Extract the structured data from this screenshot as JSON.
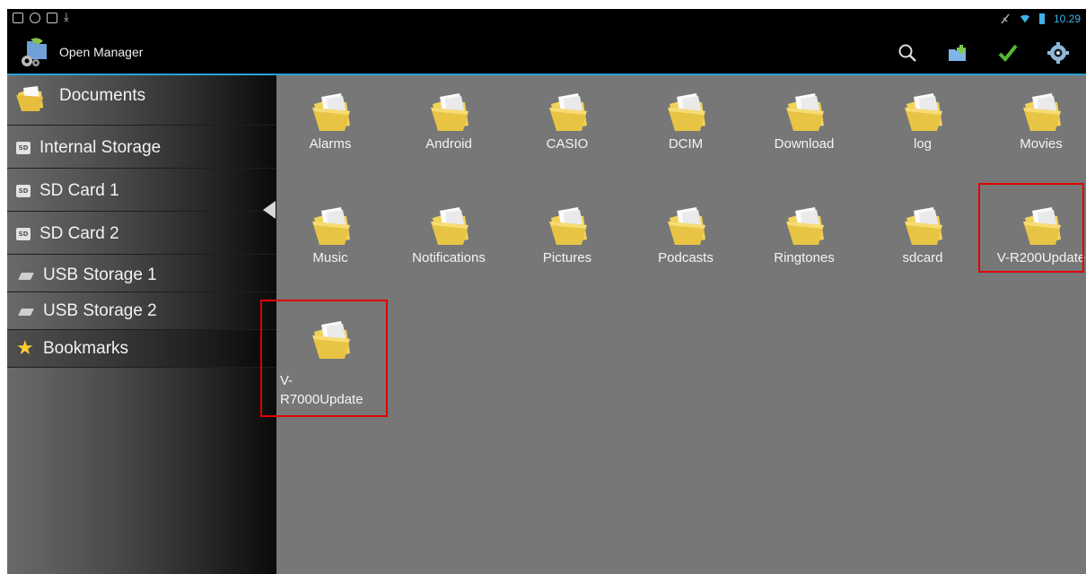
{
  "status_bar": {
    "time": "10.29",
    "left_icons": [
      "window-icon",
      "eye-icon",
      "window-icon",
      "download-icon"
    ],
    "right_icons": [
      "no-signal-icon",
      "wifi-icon",
      "battery-icon"
    ],
    "time_color": "#3fb2e8"
  },
  "action_bar": {
    "title": "Open Manager",
    "actions": [
      {
        "name": "search-icon"
      },
      {
        "name": "new-folder-icon"
      },
      {
        "name": "check-icon"
      },
      {
        "name": "settings-icon"
      }
    ],
    "accent_color": "#2aa3cf"
  },
  "sidebar": {
    "items": [
      {
        "label": "Documents",
        "icon": "folder-icon"
      },
      {
        "label": "Internal Storage",
        "icon": "sd-card-icon",
        "selected": true
      },
      {
        "label": "SD Card 1",
        "icon": "sd-card-icon"
      },
      {
        "label": "SD Card 2",
        "icon": "sd-card-icon"
      },
      {
        "label": "USB Storage 1",
        "icon": "usb-icon"
      },
      {
        "label": "USB Storage 2",
        "icon": "usb-icon"
      },
      {
        "label": "Bookmarks",
        "icon": "star-icon"
      }
    ],
    "sd_badge": "SD"
  },
  "folders": [
    {
      "name": "Alarms"
    },
    {
      "name": "Android"
    },
    {
      "name": "CASIO"
    },
    {
      "name": "DCIM"
    },
    {
      "name": "Download"
    },
    {
      "name": "log"
    },
    {
      "name": "Movies"
    },
    {
      "name": "Music"
    },
    {
      "name": "Notifications"
    },
    {
      "name": "Pictures"
    },
    {
      "name": "Podcasts"
    },
    {
      "name": "Ringtones"
    },
    {
      "name": "sdcard"
    },
    {
      "name": "V-R200Update",
      "highlighted": true
    },
    {
      "name": "V-\nR7000Update",
      "highlighted": true
    }
  ],
  "colors": {
    "folder_yellow": "#f2d25a",
    "highlight_red": "#e00000"
  }
}
